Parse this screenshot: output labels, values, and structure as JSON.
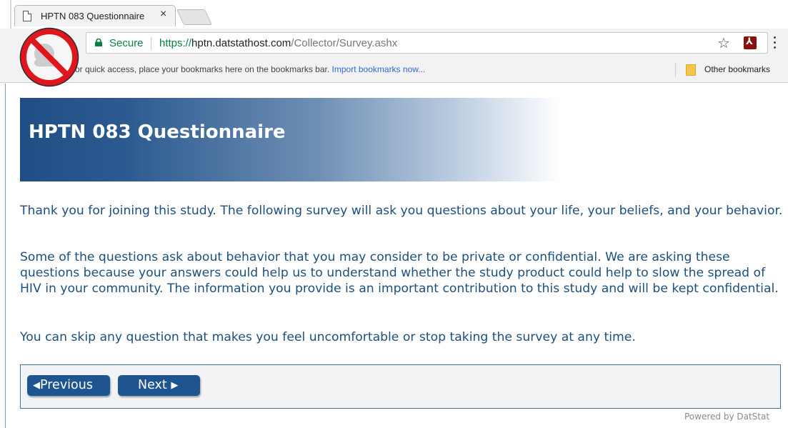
{
  "browser": {
    "tab_title": "HPTN 083 Questionnaire",
    "tab_close": "×",
    "secure_label": "Secure",
    "url_scheme": "https://",
    "url_host": "hptn.datstathost.com",
    "url_path": "/Collector/Survey.ashx",
    "bookmarks_hint": "or quick access, place your bookmarks here on the bookmarks bar.",
    "import_bookmarks": "Import bookmarks now...",
    "other_bookmarks": "Other bookmarks",
    "star_glyph": "☆",
    "pdf_glyph": "⅄"
  },
  "survey": {
    "title": "HPTN 083 Questionnaire",
    "paragraphs": [
      "Thank you for joining this study. The following survey will ask you questions about your life, your beliefs, and your behavior.",
      "Some of the questions ask about behavior that you may consider to be private or confidential. We are asking these questions because your answers could help us to understand whether the study product could help to slow the spread of HIV in your community. The information you provide is an important contribution to this study and will be kept confidential.",
      "You can skip any question that makes you feel uncomfortable or stop taking the survey at any time."
    ],
    "previous_label": "Previous",
    "next_label": "Next",
    "prev_arrow": "◀",
    "next_arrow": "▶",
    "powered_by": "Powered by DatStat"
  },
  "colors": {
    "banner_dark": "#1f4e85",
    "body_text": "#1d4f7f",
    "button": "#1e5590",
    "secure_green": "#0b8043",
    "no_sign_red": "#e0161f"
  },
  "icons": [
    "page-icon",
    "close-icon",
    "lock-icon",
    "star-icon",
    "pdf-icon",
    "menu-icon",
    "folder-icon",
    "no-sign-icon",
    "arrow-left-icon",
    "arrow-right-icon"
  ]
}
